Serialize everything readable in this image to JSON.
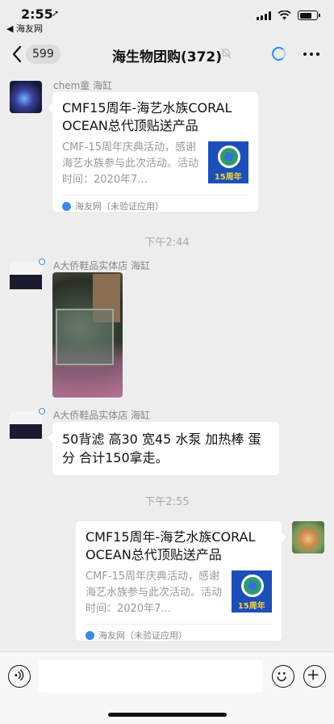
{
  "status_bar": {
    "time": "2:55",
    "back_app": "◀ 海友网"
  },
  "nav": {
    "unread_count": "599",
    "title": "海生物团购(372)"
  },
  "messages": [
    {
      "sender": "chem童 海缸",
      "card_title": "CMF15周年-海艺水族CORAL OCEAN总代顶贴送产品",
      "card_desc": "CMF-15周年庆典活动，感谢海艺水族参与此次活动。活动时间：2020年7...",
      "thumb_badge": "15周年",
      "card_source": "海友网（未验证应用）"
    },
    {
      "timestamp": "下午2:44"
    },
    {
      "sender": "A大侨鞋品实体店 海缸"
    },
    {
      "sender": "A大侨鞋品实体店 海缸",
      "text": "50背滤 高30 宽45 水泵 加热棒 蛋分 合计150拿走。"
    },
    {
      "timestamp": "下午2:55"
    },
    {
      "card_title": "CMF15周年-海艺水族CORAL OCEAN总代顶贴送产品",
      "card_desc": "CMF-15周年庆典活动，感谢海艺水族参与此次活动。活动时间：2020年7...",
      "thumb_badge": "15周年",
      "card_source": "海友网（未验证应用）"
    }
  ],
  "colors": {
    "background": "#ededed",
    "bubble": "#ffffff",
    "accent_blue": "#2f8cf0"
  }
}
